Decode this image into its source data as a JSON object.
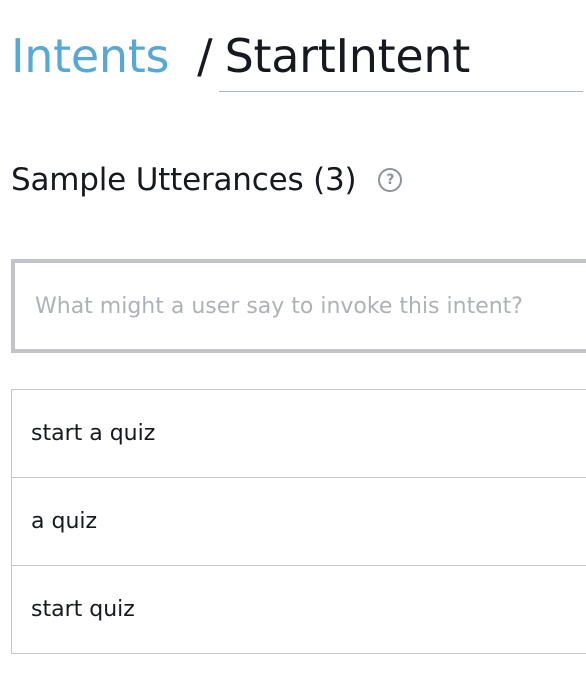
{
  "breadcrumb": {
    "parent_label": "Intents",
    "separator": "/",
    "current_label": "StartIntent"
  },
  "section": {
    "title": "Sample Utterances (3)",
    "help_icon": "question-circle-icon",
    "help_glyph": "?"
  },
  "utterance_input": {
    "value": "",
    "placeholder": "What might a user say to invoke this intent?"
  },
  "utterances": [
    {
      "text": "start a quiz"
    },
    {
      "text": "a quiz"
    },
    {
      "text": "start quiz"
    }
  ],
  "colors": {
    "link": "#57a7d8",
    "text": "#16191f",
    "input_border": "#c1c3c9",
    "row_border": "#c4c8cc",
    "placeholder": "#aeb2b8"
  }
}
